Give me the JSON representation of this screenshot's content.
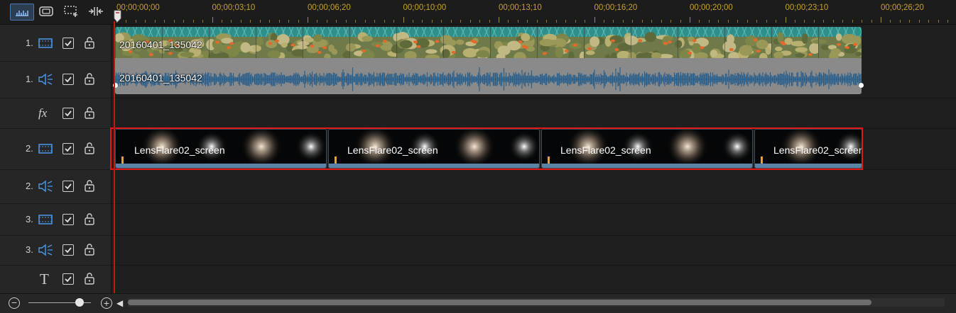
{
  "toolbar": {
    "buttons": [
      {
        "name": "timeline-view",
        "icon": "ruler-icon",
        "active": true
      },
      {
        "name": "storyboard-view",
        "icon": "storyboard-icon",
        "active": false
      },
      {
        "name": "add-track",
        "icon": "add-track-icon",
        "active": false
      },
      {
        "name": "fit-timeline",
        "icon": "fit-timeline-icon",
        "active": false
      }
    ]
  },
  "ruler": {
    "timecodes": [
      "00;00;00;00",
      "00;00;03;10",
      "00;00;06;20",
      "00;00;10;00",
      "00;00;13;10",
      "00;00;16;20",
      "00;00;20;00",
      "00;00;23;10",
      "00;00;26;20"
    ]
  },
  "tracks": [
    {
      "number": "1.",
      "type": "video",
      "icon": "video-track-icon",
      "enabled": true,
      "locked": false
    },
    {
      "number": "1.",
      "type": "audio",
      "icon": "speaker-icon",
      "enabled": true,
      "locked": false
    },
    {
      "number": "",
      "type": "fx",
      "icon": "fx-icon",
      "enabled": true,
      "locked": false
    },
    {
      "number": "2.",
      "type": "video",
      "icon": "video-track-icon",
      "enabled": true,
      "locked": false
    },
    {
      "number": "2.",
      "type": "audio",
      "icon": "speaker-icon",
      "enabled": true,
      "locked": false
    },
    {
      "number": "3.",
      "type": "video",
      "icon": "video-track-icon",
      "enabled": true,
      "locked": false
    },
    {
      "number": "3.",
      "type": "audio",
      "icon": "speaker-icon",
      "enabled": true,
      "locked": false
    },
    {
      "number": "",
      "type": "title",
      "icon": "title-icon",
      "enabled": true,
      "locked": false
    }
  ],
  "clips": {
    "video1": {
      "label": "20160401_135042"
    },
    "audio1": {
      "label": "20160401_135042"
    },
    "video2": [
      {
        "label": "LensFlare02_screen"
      },
      {
        "label": "LensFlare02_screen"
      },
      {
        "label": "LensFlare02_screen"
      },
      {
        "label": "LensFlare02_screen"
      }
    ]
  },
  "colors": {
    "accent": "#4a90d9",
    "selection": "#e01818",
    "playhead": "#c01818",
    "timecode": "#c9a227"
  },
  "zoom": {
    "level": 0.82
  },
  "scroll": {
    "visible_fraction": 0.91
  }
}
